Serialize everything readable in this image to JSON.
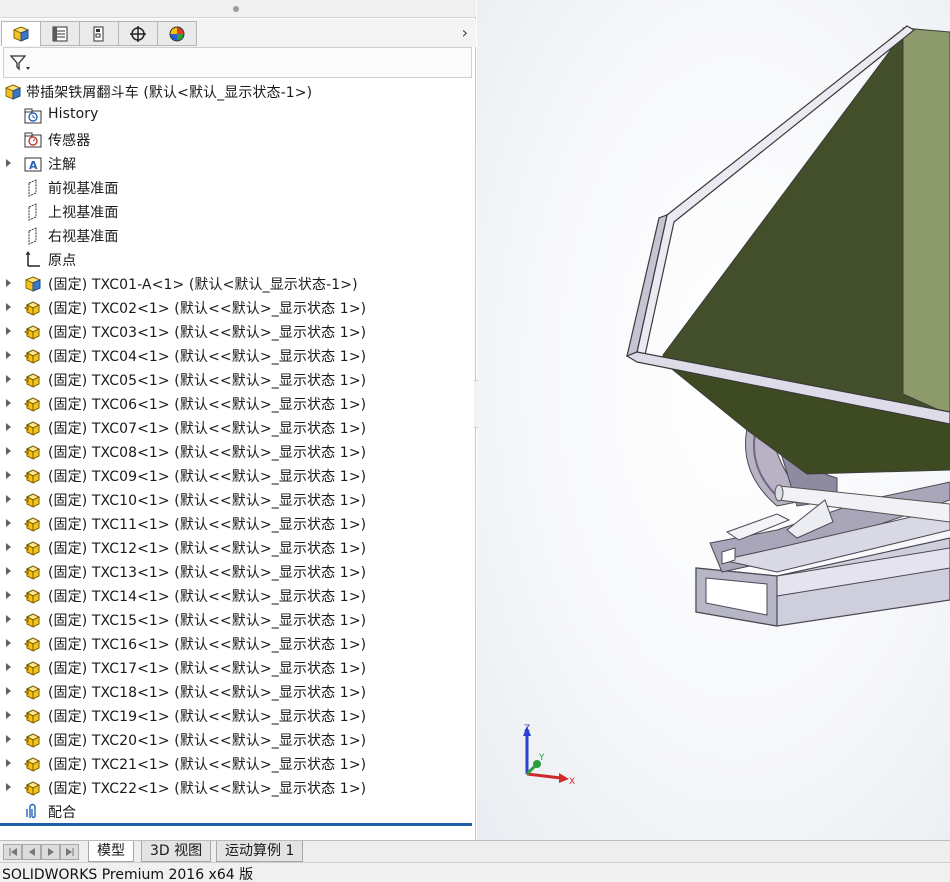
{
  "manager_tabs": [
    "featuremanager-tab",
    "propertymanager-tab",
    "configurationmanager-tab",
    "dimxpertmanager-tab",
    "displaymanager-tab"
  ],
  "tree": {
    "root": "带插架铁屑翻斗车  (默认<默认_显示状态-1>)",
    "items": [
      {
        "label": "History",
        "icon": "history-folder-icon"
      },
      {
        "label": "传感器",
        "icon": "sensors-icon"
      },
      {
        "label": "注解",
        "icon": "annotations-icon"
      },
      {
        "label": "前视基准面",
        "icon": "plane-icon"
      },
      {
        "label": "上视基准面",
        "icon": "plane-icon"
      },
      {
        "label": "右视基准面",
        "icon": "plane-icon"
      },
      {
        "label": "原点",
        "icon": "origin-icon"
      }
    ],
    "components": [
      "(固定) TXC01-A<1> (默认<默认_显示状态-1>)",
      "(固定) TXC02<1> (默认<<默认>_显示状态 1>)",
      "(固定) TXC03<1> (默认<<默认>_显示状态 1>)",
      "(固定) TXC04<1> (默认<<默认>_显示状态 1>)",
      "(固定) TXC05<1> (默认<<默认>_显示状态 1>)",
      "(固定) TXC06<1> (默认<<默认>_显示状态 1>)",
      "(固定) TXC07<1> (默认<<默认>_显示状态 1>)",
      "(固定) TXC08<1> (默认<<默认>_显示状态 1>)",
      "(固定) TXC09<1> (默认<<默认>_显示状态 1>)",
      "(固定) TXC10<1> (默认<<默认>_显示状态 1>)",
      "(固定) TXC11<1> (默认<<默认>_显示状态 1>)",
      "(固定) TXC12<1> (默认<<默认>_显示状态 1>)",
      "(固定) TXC13<1> (默认<<默认>_显示状态 1>)",
      "(固定) TXC14<1> (默认<<默认>_显示状态 1>)",
      "(固定) TXC15<1> (默认<<默认>_显示状态 1>)",
      "(固定) TXC16<1> (默认<<默认>_显示状态 1>)",
      "(固定) TXC17<1> (默认<<默认>_显示状态 1>)",
      "(固定) TXC18<1> (默认<<默认>_显示状态 1>)",
      "(固定) TXC19<1> (默认<<默认>_显示状态 1>)",
      "(固定) TXC20<1> (默认<<默认>_显示状态 1>)",
      "(固定) TXC21<1> (默认<<默认>_显示状态 1>)",
      "(固定) TXC22<1> (默认<<默认>_显示状态 1>)"
    ],
    "mates": "配合"
  },
  "doc_tabs": [
    "模型",
    "3D 视图",
    "运动算例 1"
  ],
  "status": "SOLIDWORKS Premium 2016 x64 版",
  "triad": {
    "x": "X",
    "y": "Y",
    "z": "Z"
  },
  "colors": {
    "hopper_dark": "#434f2a",
    "hopper_light": "#8d9a6b",
    "frame_steel": "#c9c8d8",
    "selection_line": "#1f5fa8",
    "part_yellow": "#f0b400"
  }
}
